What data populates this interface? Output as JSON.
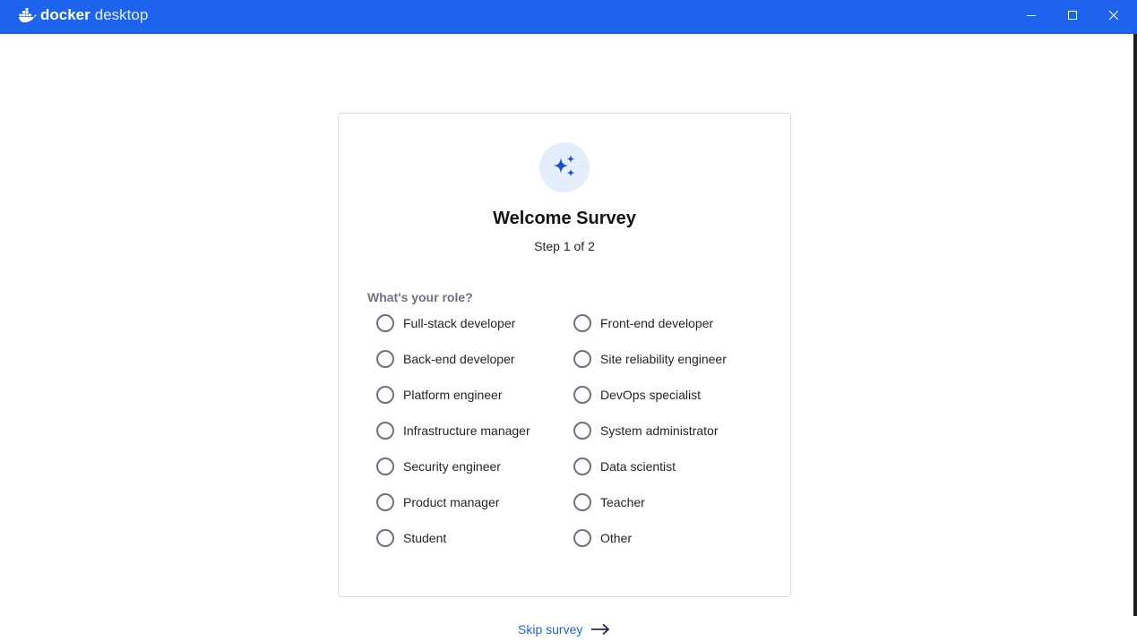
{
  "app": {
    "brand_word1": "docker",
    "brand_word2": "desktop",
    "accent_color": "#1d63ed"
  },
  "window_controls": {
    "minimize_icon": "minimize-icon",
    "maximize_icon": "maximize-icon",
    "close_icon": "close-icon"
  },
  "survey": {
    "icon": "sparkles-icon",
    "title": "Welcome Survey",
    "step": "Step 1 of 2",
    "question": "What's your role?",
    "selected": null,
    "options": [
      "Full-stack developer",
      "Front-end developer",
      "Back-end developer",
      "Site reliability engineer",
      "Platform engineer",
      "DevOps specialist",
      "Infrastructure manager",
      "System administrator",
      "Security engineer",
      "Data scientist",
      "Product manager",
      "Teacher",
      "Student",
      "Other"
    ]
  },
  "footer": {
    "skip_label": "Skip survey",
    "skip_icon": "arrow-right-icon"
  }
}
